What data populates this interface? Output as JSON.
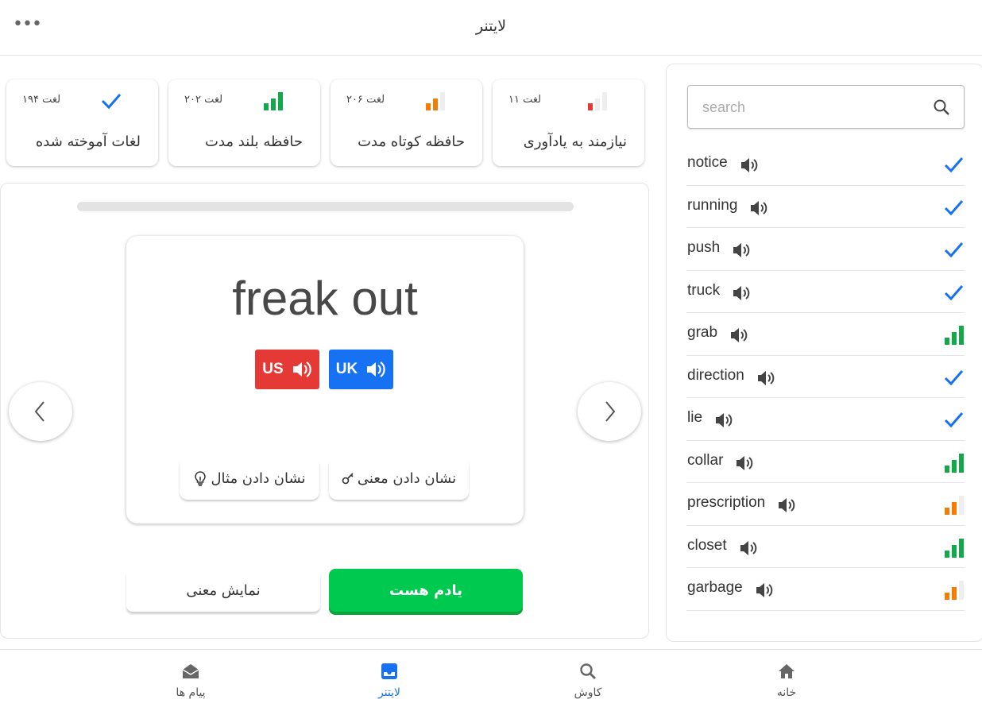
{
  "app": {
    "title": "لایتنر",
    "more_label": "•••"
  },
  "stats": [
    {
      "count": "۱۱ لغت",
      "label": "نیازمند به یادآوری",
      "level": 1,
      "icon": "signal-low-icon"
    },
    {
      "count": "۲۰۶ لغت",
      "label": "حافظه کوتاه مدت",
      "level": 2,
      "icon": "signal-mid-icon"
    },
    {
      "count": "۲۰۲ لغت",
      "label": "حافظه بلند مدت",
      "level": 3,
      "icon": "signal-high-icon"
    },
    {
      "count": "۱۹۴ لغت",
      "label": "لغات آموخته شده",
      "level": 4,
      "icon": "check-icon"
    }
  ],
  "flashcard": {
    "word": "freak out",
    "us_label": "US",
    "uk_label": "UK",
    "show_meaning_label": "نشان دادن معنی",
    "show_example_label": "نشان دادن مثال"
  },
  "actions": {
    "know_label": "یادم هست",
    "show_meaning_label": "نمایش معنی"
  },
  "search": {
    "placeholder": "search"
  },
  "words": [
    {
      "word": "notice",
      "status": "learned"
    },
    {
      "word": "running",
      "status": "learned"
    },
    {
      "word": "push",
      "status": "learned"
    },
    {
      "word": "truck",
      "status": "learned"
    },
    {
      "word": "grab",
      "status": "long-term"
    },
    {
      "word": "direction",
      "status": "learned"
    },
    {
      "word": "lie",
      "status": "learned"
    },
    {
      "word": "collar",
      "status": "long-term"
    },
    {
      "word": "prescription",
      "status": "short-term"
    },
    {
      "word": "closet",
      "status": "long-term"
    },
    {
      "word": "garbage",
      "status": "short-term"
    }
  ],
  "nav": [
    {
      "label": "پیام ها",
      "icon": "mail-icon",
      "active": false
    },
    {
      "label": "لایتنر",
      "icon": "inbox-icon",
      "active": true
    },
    {
      "label": "کاوش",
      "icon": "search-icon",
      "active": false
    },
    {
      "label": "خانه",
      "icon": "home-icon",
      "active": false
    }
  ],
  "colors": {
    "accent": "#1672f2",
    "us": "#e53935",
    "green": "#00c950",
    "bar_green": "#13a84a",
    "bar_orange": "#f57c00",
    "bar_red": "#e53935",
    "bar_empty": "#eeeeee"
  }
}
